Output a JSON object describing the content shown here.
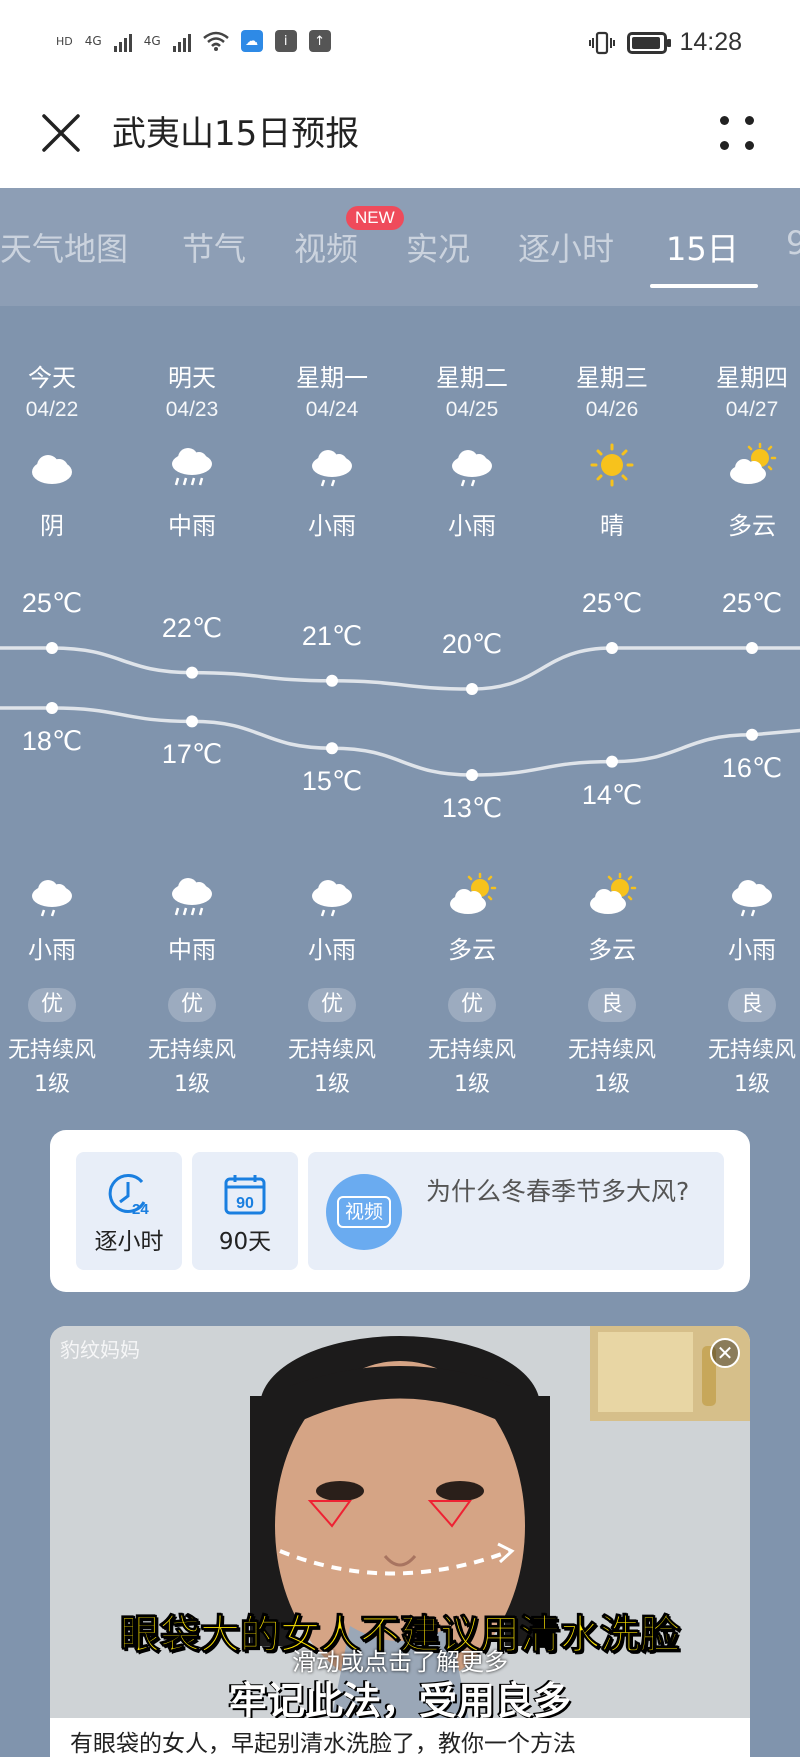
{
  "status_bar": {
    "left_labels": [
      "HD",
      "4G",
      "4G"
    ],
    "time": "14:28"
  },
  "header": {
    "title": "武夷山15日预报"
  },
  "tabs": [
    {
      "label": "天气地图",
      "active": false
    },
    {
      "label": "节气",
      "active": false
    },
    {
      "label": "视频",
      "active": false,
      "badge": "NEW"
    },
    {
      "label": "实况",
      "active": false
    },
    {
      "label": "逐小时",
      "active": false
    },
    {
      "label": "15日",
      "active": true
    },
    {
      "label": "9",
      "active": false
    }
  ],
  "forecast": {
    "days": [
      {
        "name": "今天",
        "date": "04/22",
        "day_icon": "cloud-icon",
        "day_cond": "阴",
        "high": "25℃",
        "low": "18℃",
        "night_icon": "rain-cloud-icon",
        "night_cond": "小雨",
        "aqi": "优",
        "wind": "无持续风",
        "wind_level": "1级"
      },
      {
        "name": "明天",
        "date": "04/23",
        "day_icon": "heavy-rain-icon",
        "day_cond": "中雨",
        "high": "22℃",
        "low": "17℃",
        "night_icon": "heavy-rain-icon",
        "night_cond": "中雨",
        "aqi": "优",
        "wind": "无持续风",
        "wind_level": "1级"
      },
      {
        "name": "星期一",
        "date": "04/24",
        "day_icon": "rain-cloud-icon",
        "day_cond": "小雨",
        "high": "21℃",
        "low": "15℃",
        "night_icon": "rain-cloud-icon",
        "night_cond": "小雨",
        "aqi": "优",
        "wind": "无持续风",
        "wind_level": "1级"
      },
      {
        "name": "星期二",
        "date": "04/25",
        "day_icon": "rain-cloud-icon",
        "day_cond": "小雨",
        "high": "20℃",
        "low": "13℃",
        "night_icon": "partly-cloudy-icon",
        "night_cond": "多云",
        "aqi": "优",
        "wind": "无持续风",
        "wind_level": "1级"
      },
      {
        "name": "星期三",
        "date": "04/26",
        "day_icon": "sun-icon",
        "day_cond": "晴",
        "high": "25℃",
        "low": "14℃",
        "night_icon": "partly-cloudy-icon",
        "night_cond": "多云",
        "aqi": "良",
        "wind": "无持续风",
        "wind_level": "1级"
      },
      {
        "name": "星期四",
        "date": "04/27",
        "day_icon": "partly-cloudy-icon",
        "day_cond": "多云",
        "high": "25℃",
        "low": "16℃",
        "night_icon": "rain-cloud-icon",
        "night_cond": "小雨",
        "aqi": "良",
        "wind": "无持续风",
        "wind_level": "1级"
      }
    ]
  },
  "quick_links": {
    "hourly": {
      "label": "逐小时",
      "icon_text": "24"
    },
    "ninety": {
      "label": "90天",
      "icon_text": "90"
    },
    "video": {
      "icon_text": "视频",
      "text": "为什么冬春季节多大风?"
    }
  },
  "ad": {
    "logo": "豹纹妈妈",
    "close": "✕",
    "headline": "眼袋大的女人不建议用清水洗脸",
    "hint": "滑动或点击了解更多",
    "sub": "牢记此法，受用良多",
    "caption": "有眼袋的女人，早起别清水洗脸了，教你一个方法"
  },
  "colors": {
    "sky": "#8094ad",
    "accent_blue": "#1a7fe0",
    "badge_red": "#ef4b5b",
    "headline_yellow": "#ffe600"
  }
}
